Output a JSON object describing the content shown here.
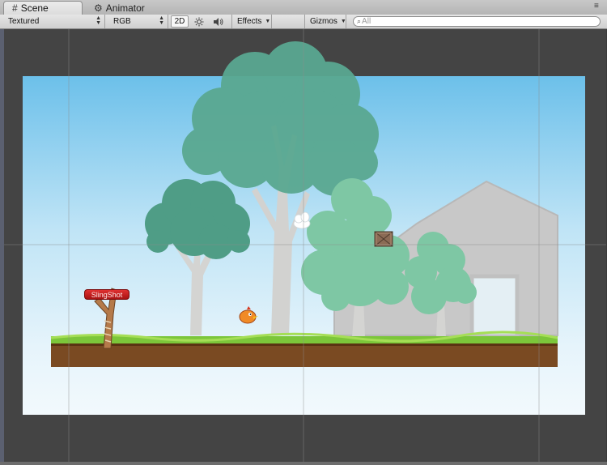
{
  "tabs": [
    {
      "label": "Scene",
      "icon": "grid-icon",
      "active": true
    },
    {
      "label": "Animator",
      "icon": "animator-icon",
      "active": false
    }
  ],
  "toolbar": {
    "draw_mode": "Textured",
    "render_mode": "RGB",
    "mode_2d": "2D",
    "effects": "Effects",
    "gizmos": "Gizmos",
    "search_placeholder": "All"
  },
  "scene": {
    "objects": [
      {
        "name": "SlingShot",
        "label": "SlingShot"
      },
      {
        "name": "Bird"
      },
      {
        "name": "Crate"
      },
      {
        "name": "Cloud"
      },
      {
        "name": "Ground"
      },
      {
        "name": "Barn"
      },
      {
        "name": "Trees"
      }
    ]
  },
  "colors": {
    "tree_green": "#5aab8c",
    "sky_top": "#6cc0ea",
    "grass": "#7cc63a",
    "dirt": "#7a4a22",
    "label_red": "#c51f1f"
  }
}
